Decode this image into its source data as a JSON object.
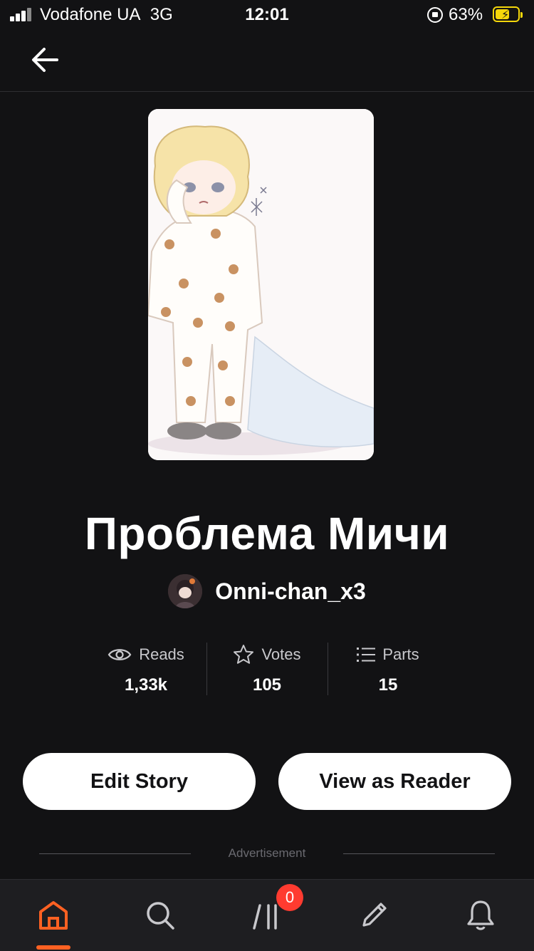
{
  "status_bar": {
    "carrier": "Vodafone UA",
    "network": "3G",
    "time": "12:01",
    "battery": "63%",
    "battery_level": 0.63
  },
  "story": {
    "title": "Проблема Мичи",
    "author": "Onni-chan_x3"
  },
  "stats": [
    {
      "label": "Reads",
      "value": "1,33k",
      "icon": "eye-icon"
    },
    {
      "label": "Votes",
      "value": "105",
      "icon": "star-icon"
    },
    {
      "label": "Parts",
      "value": "15",
      "icon": "list-icon"
    }
  ],
  "actions": {
    "edit_label": "Edit Story",
    "view_label": "View as Reader"
  },
  "ad_label": "Advertisement",
  "tabbar": {
    "items": [
      "home-icon",
      "search-icon",
      "library-icon",
      "pencil-icon",
      "bell-icon"
    ],
    "active": "home-icon",
    "library_badge": "0",
    "accent": "#ff6122"
  }
}
